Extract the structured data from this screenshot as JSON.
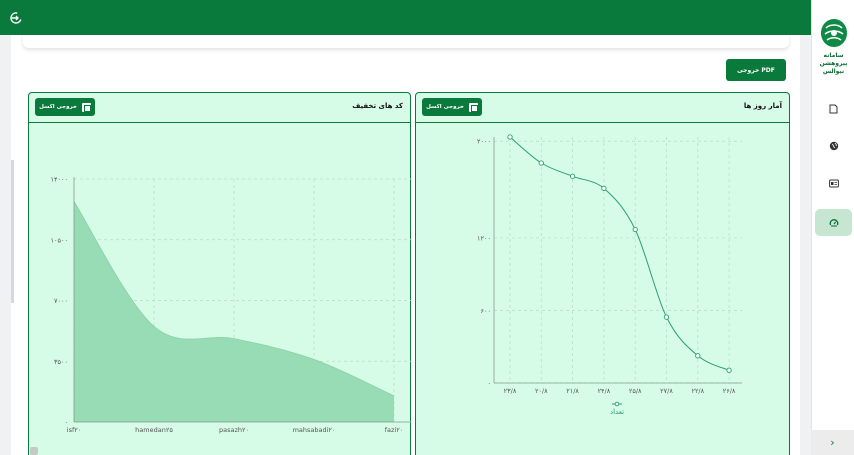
{
  "sidebar": {
    "brand": "سامانه پیروهشن\nنیوالس",
    "nav": [
      {
        "icon": "document-icon"
      },
      {
        "icon": "globe-icon"
      },
      {
        "icon": "id-card-icon"
      },
      {
        "icon": "dashboard-icon",
        "active": true
      }
    ],
    "expand": "›"
  },
  "toolbar": {
    "pdf_label": "خروجی PDF"
  },
  "panels": {
    "daily": {
      "title": "آمار روز ها",
      "excel_label": "خروجی اکسل"
    },
    "discount": {
      "title": "کد های تخفیف",
      "excel_label": "خروجی اکسل"
    }
  },
  "colors": {
    "brand": "#0a7a3c",
    "panel_bg": "#d6fbe6",
    "area_fill": "#98dcb6",
    "line": "#2aa072"
  },
  "chart_data": [
    {
      "type": "line",
      "title": "آمار روز ها",
      "x": [
        "۲۳/۸",
        "۲۰/۸",
        "۲۱/۸",
        "۲۴/۸",
        "۲۵/۸",
        "۲۷/۸",
        "۲۲/۸",
        "۲۶/۸"
      ],
      "series": [
        {
          "name": "تعداد",
          "values": [
            2035,
            1820,
            1710,
            1610,
            1270,
            545,
            225,
            105
          ]
        }
      ],
      "y_ticks": [
        "۰",
        "۶۰۰",
        "۱۲۰۰",
        "۲۰۰۰"
      ],
      "ylim": [
        0,
        2035
      ],
      "grid": true,
      "legend": "bottom"
    },
    {
      "type": "area",
      "title": "کد های تخفیف",
      "x": [
        "isf۲۰",
        "hamedan۲۵",
        "pasazh۲۰",
        "mahsabadi۲۰",
        "fazi۲۰"
      ],
      "series": [
        {
          "values": [
            12700,
            5500,
            4800,
            3600,
            1500
          ]
        }
      ],
      "y_ticks": [
        "۰",
        "۳۵۰۰",
        "۷۰۰۰",
        "۱۰۵۰۰",
        "۱۴۰۰۰"
      ],
      "ylim": [
        0,
        14000
      ],
      "grid": true
    }
  ]
}
